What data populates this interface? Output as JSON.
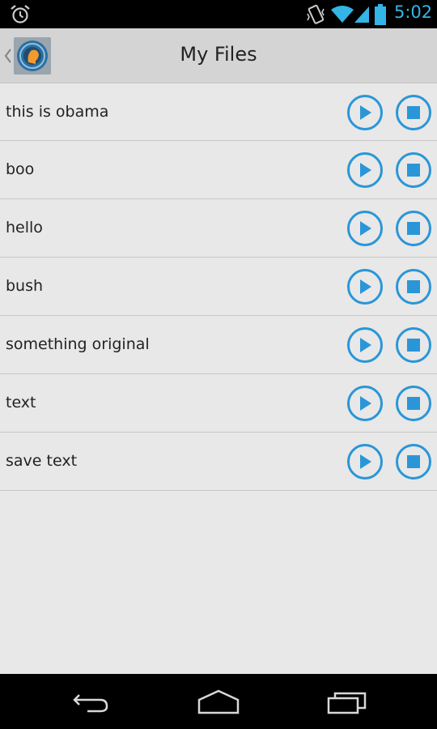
{
  "status_bar": {
    "time": "5:02",
    "icons": [
      "alarm-icon",
      "vibrate-icon",
      "wifi-icon",
      "signal-icon",
      "battery-icon"
    ],
    "accent_color": "#33b5e5"
  },
  "action_bar": {
    "title": "My Files",
    "app_icon": "app-logo-icon"
  },
  "files": [
    {
      "name": "this is obama"
    },
    {
      "name": "boo"
    },
    {
      "name": "hello"
    },
    {
      "name": "bush"
    },
    {
      "name": "something original"
    },
    {
      "name": "text"
    },
    {
      "name": "save text"
    }
  ],
  "controls": {
    "play_icon": "play-icon",
    "stop_icon": "stop-icon",
    "color": "#2a96d8"
  },
  "nav_bar": {
    "buttons": [
      "back-icon",
      "home-icon",
      "recents-icon"
    ]
  }
}
